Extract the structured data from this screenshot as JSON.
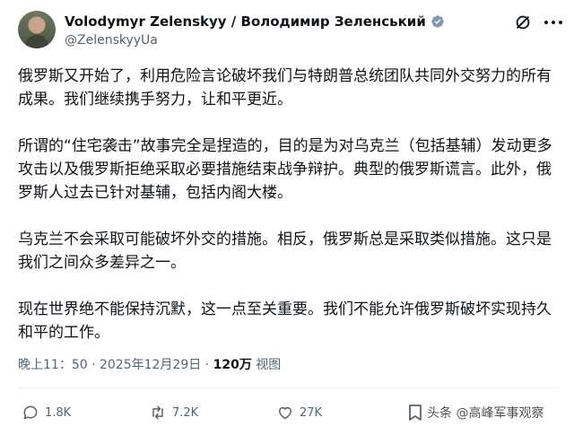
{
  "author": {
    "name": "Volodymyr Zelenskyy / Володимир Зеленський",
    "handle": "@ZelenskyyUa",
    "verified_color": "#829aab"
  },
  "post": {
    "paragraphs": [
      "俄罗斯又开始了，利用危险言论破坏我们与特朗普总统团队共同外交努力的所有成果。我们继续携手努力，让和平更近。",
      "所谓的“住宅袭击”故事完全是捏造的，目的是为对乌克兰（包括基辅）发动更多攻击以及俄罗斯拒绝采取必要措施结束战争辩护。典型的俄罗斯谎言。此外，俄罗斯人过去已针对基辅，包括内阁大楼。",
      "乌克兰不会采取可能破坏外交的措施。相反，俄罗斯总是采取类似措施。这只是我们之间众多差异之一。",
      "现在世界绝不能保持沉默，这一点至关重要。我们不能允许俄罗斯破坏实现持久和平的工作。"
    ],
    "timestamp": "晚上11：50 · 2025年12月29日 · ",
    "views_count": "120万",
    "views_label": " 视图"
  },
  "actions": {
    "replies": "1.8K",
    "reposts": "7.2K",
    "likes": "27K"
  },
  "watermark": "头条 @高峰军事观察",
  "icons": [
    "verified-badge-icon",
    "grok-icon",
    "more-icon",
    "reply-icon",
    "repost-icon",
    "like-icon",
    "bookmark-icon"
  ]
}
